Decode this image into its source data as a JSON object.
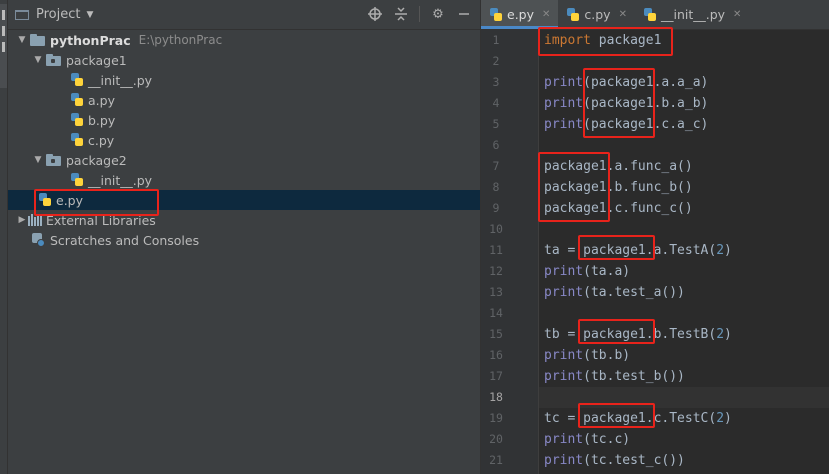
{
  "panel": {
    "title": "Project",
    "icons": [
      "target-icon",
      "collapse-icon",
      "gear-icon",
      "minimize-icon"
    ]
  },
  "tree": {
    "root": {
      "label": "pythonPrac",
      "path": "E:\\pythonPrac"
    },
    "package1": {
      "label": "package1",
      "files": [
        "__init__.py",
        "a.py",
        "b.py",
        "c.py"
      ]
    },
    "package2": {
      "label": "package2",
      "files": [
        "__init__.py"
      ]
    },
    "e_py": "e.py",
    "external": "External Libraries",
    "scratches": "Scratches and Consoles"
  },
  "editor": {
    "tabs": [
      {
        "label": "e.py",
        "active": true
      },
      {
        "label": "c.py",
        "active": false
      },
      {
        "label": "__init__.py",
        "active": false
      }
    ],
    "current_line": 18,
    "lines": [
      {
        "n": "1",
        "t": "import package1"
      },
      {
        "n": "2",
        "t": ""
      },
      {
        "n": "3",
        "t": "print(package1.a.a_a)"
      },
      {
        "n": "4",
        "t": "print(package1.b.a_b)"
      },
      {
        "n": "5",
        "t": "print(package1.c.a_c)"
      },
      {
        "n": "6",
        "t": ""
      },
      {
        "n": "7",
        "t": "package1.a.func_a()"
      },
      {
        "n": "8",
        "t": "package1.b.func_b()"
      },
      {
        "n": "9",
        "t": "package1.c.func_c()"
      },
      {
        "n": "10",
        "t": ""
      },
      {
        "n": "11",
        "t": "ta = package1.a.TestA(2)"
      },
      {
        "n": "12",
        "t": "print(ta.a)"
      },
      {
        "n": "13",
        "t": "print(ta.test_a())"
      },
      {
        "n": "14",
        "t": ""
      },
      {
        "n": "15",
        "t": "tb = package1.b.TestB(2)"
      },
      {
        "n": "16",
        "t": "print(tb.b)"
      },
      {
        "n": "17",
        "t": "print(tb.test_b())"
      },
      {
        "n": "18",
        "t": ""
      },
      {
        "n": "19",
        "t": "tc = package1.c.TestC(2)"
      },
      {
        "n": "20",
        "t": "print(tc.c)"
      },
      {
        "n": "21",
        "t": "print(tc.test_c())"
      }
    ]
  },
  "colors": {
    "keyword": "#cc7832",
    "builtin": "#8888c6",
    "number": "#6897bb",
    "text": "#a9b7c6",
    "highlight_box": "#e8231b",
    "selection": "#0d293e"
  }
}
